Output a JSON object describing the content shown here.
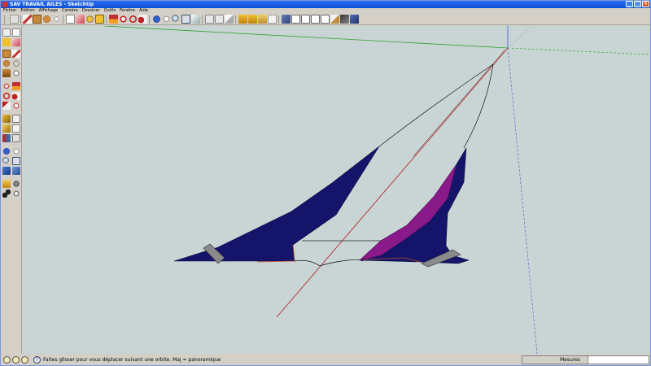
{
  "window": {
    "title": "SAV TRAVAIL AILES - SketchUp"
  },
  "menu": [
    "Fichier",
    "Edition",
    "Affichage",
    "Caméra",
    "Dessiner",
    "Outils",
    "Fenêtre",
    "Aide"
  ],
  "status": {
    "text": "Faites glisser pour vous déplacer suivant une orbite.  Maj = panoramique",
    "measure_label": "Mesures",
    "measure_value": ""
  },
  "colors": {
    "viewport_bg": "#c9d4d4",
    "wing_blue": "#14146a",
    "wing_magenta": "#8a1a8a",
    "axis_red": "#b03030",
    "axis_green": "#2fa02f",
    "axis_blue": "#3a5ad8"
  },
  "icons": {
    "toolbar": [
      "pencil-icon",
      "rectangle-icon",
      "circle-icon",
      "erase-icon",
      "pushpull-icon",
      "move-icon",
      "rotate-icon",
      "followme-icon",
      "offset-icon",
      "orbit-icon",
      "pan-icon",
      "zoom-icon",
      "zoom-extents-icon",
      "tape-icon",
      "text-icon",
      "paint-icon",
      "section-icon",
      "view-iso-icon",
      "view-top-icon",
      "view-front-icon",
      "view-right-icon",
      "view-back-icon",
      "view-left-icon",
      "xray-icon",
      "wireframe-icon",
      "shaded-icon",
      "textured-icon",
      "monochrome-icon"
    ],
    "lefttools": [
      "select-icon",
      "component-icon",
      "paint-bucket-icon",
      "eraser-icon",
      "rectangle-icon",
      "line-icon",
      "circle-icon",
      "arc-icon",
      "polygon-icon",
      "freehand-icon",
      "move-icon",
      "pushpull-icon",
      "rotate-icon",
      "followme-icon",
      "scale-icon",
      "offset-icon",
      "tape-measure-icon",
      "dimension-icon",
      "protractor-icon",
      "text-icon",
      "axes-icon",
      "3d-text-icon",
      "orbit-icon",
      "pan-icon",
      "zoom-icon",
      "zoom-window-icon",
      "zoom-extents-icon",
      "previous-view-icon",
      "position-camera-icon",
      "look-around-icon",
      "walk-icon",
      "section-plane-icon"
    ]
  }
}
